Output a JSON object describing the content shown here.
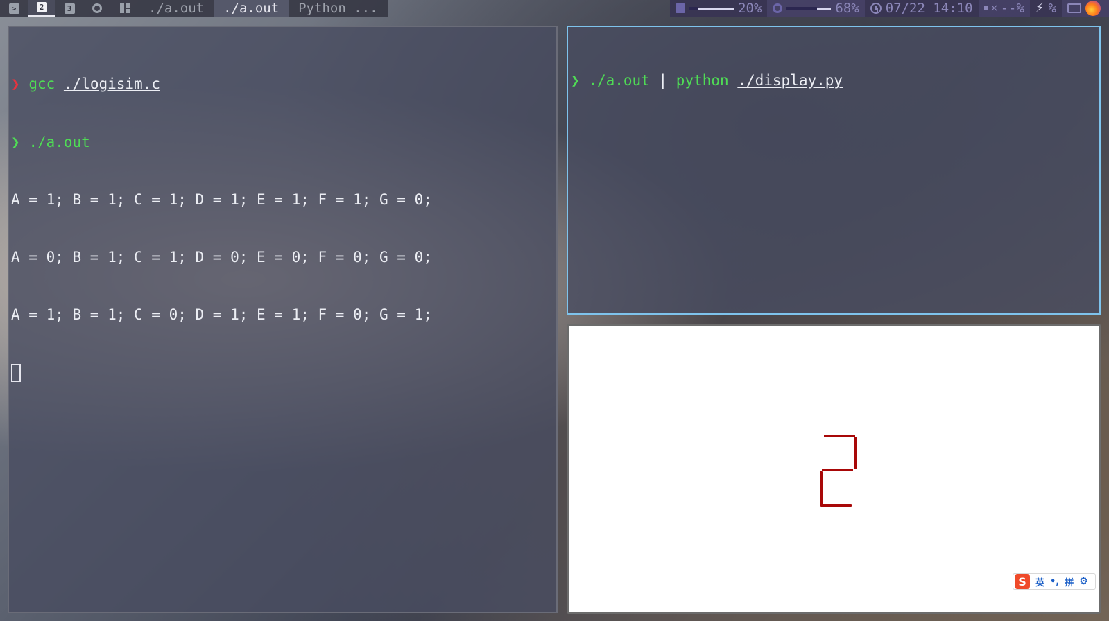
{
  "topbar": {
    "workspaces": [
      {
        "label": "",
        "icon": "terminal-icon",
        "active": false
      },
      {
        "label": "2",
        "icon": "workspace-2-icon",
        "active": true
      },
      {
        "label": "3",
        "icon": "workspace-3-icon",
        "active": false
      },
      {
        "label": "",
        "icon": "chrome-icon",
        "active": false
      },
      {
        "label": "",
        "icon": "layout-icon",
        "active": false
      }
    ],
    "window_tabs": [
      "./a.out",
      "./a.out",
      "Python ..."
    ],
    "active_tab_index": 1,
    "memory": {
      "icon": "memory-chip-icon",
      "percent": 20,
      "label": "20%"
    },
    "cpu": {
      "icon": "cpu-icon",
      "percent": 68,
      "label": "68%"
    },
    "datetime": {
      "icon": "clock-icon",
      "label": "07/22 14:10"
    },
    "volume": {
      "icon": "volume-muted-icon",
      "label": "--%"
    },
    "battery_label": "%",
    "colors": {
      "accent": "#7ec3ec",
      "prompt_red": "#e8333f",
      "prompt_green": "#4fdb55",
      "segment": "#a80808"
    }
  },
  "terminal_left": {
    "lines": [
      {
        "prompt": "❯",
        "prompt_color": "red",
        "cmd": "gcc",
        "arg": "./logisim.c"
      },
      {
        "prompt": "❯",
        "prompt_color": "green",
        "cmd": "./a.out",
        "arg": ""
      }
    ],
    "output": [
      "A = 1; B = 1; C = 1; D = 1; E = 1; F = 1; G = 0;",
      "A = 0; B = 1; C = 1; D = 0; E = 0; F = 0; G = 0;",
      "A = 1; B = 1; C = 0; D = 1; E = 1; F = 0; G = 1;"
    ]
  },
  "terminal_right": {
    "prompt": "❯",
    "cmd1": "./a.out",
    "pipe": "|",
    "cmd2": "python",
    "arg": "./display.py"
  },
  "display": {
    "digit": "2",
    "segments": {
      "A": 1,
      "B": 1,
      "C": 0,
      "D": 1,
      "E": 1,
      "F": 0,
      "G": 1
    }
  },
  "ime": {
    "logo": "S",
    "lang": "英",
    "punct": "•,",
    "mode": "拼",
    "settings_icon": "gear-icon"
  }
}
